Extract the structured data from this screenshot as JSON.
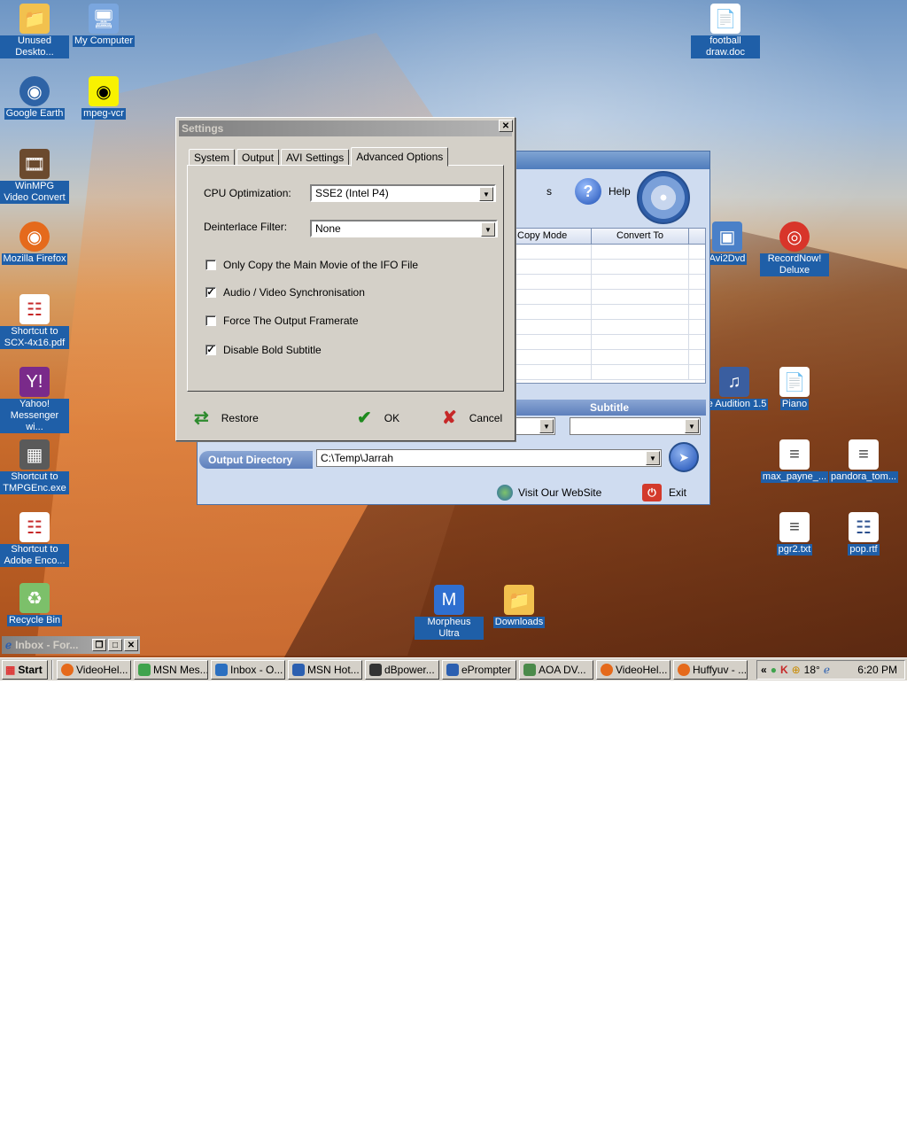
{
  "desktop_icons": [
    {
      "label": "Unused Deskto...",
      "icon": "folder-icon",
      "color": "#f2c14e"
    },
    {
      "label": "My Computer",
      "icon": "computer-icon",
      "color": "#7aa6de"
    },
    {
      "label": "football draw.doc",
      "icon": "document-icon",
      "color": "#ffffff"
    },
    {
      "label": "Google Earth",
      "icon": "globe-icon",
      "color": "#2e63a6"
    },
    {
      "label": "mpeg-vcr",
      "icon": "mpeg-vcr-icon",
      "color": "#f8f200"
    },
    {
      "label": "WinMPG Video Convert",
      "icon": "film-icon",
      "color": "#6b4a2e"
    },
    {
      "label": "Mozilla Firefox",
      "icon": "firefox-icon",
      "color": "#e56a1c"
    },
    {
      "label": "Shortcut to SCX-4x16.pdf",
      "icon": "pdf-icon",
      "color": "#ffffff"
    },
    {
      "label": "Avi2Dvd",
      "icon": "cube-icon",
      "color": "#4a80c8"
    },
    {
      "label": "RecordNow! Deluxe",
      "icon": "cd-icon",
      "color": "#d8352a"
    },
    {
      "label": "Yahoo! Messenger wi...",
      "icon": "yahoo-icon",
      "color": "#7a2a8a"
    },
    {
      "label": "be Audition 1.5",
      "icon": "audition-icon",
      "color": "#3a5ea0"
    },
    {
      "label": "Piano",
      "icon": "document-icon",
      "color": "#ffffff"
    },
    {
      "label": "Shortcut to TMPGEnc.exe",
      "icon": "tmpgenc-icon",
      "color": "#5a5a5a"
    },
    {
      "label": "max_payne_...",
      "icon": "textfile-icon",
      "color": "#ffffff"
    },
    {
      "label": "pandora_tom...",
      "icon": "textfile-icon",
      "color": "#ffffff"
    },
    {
      "label": "Shortcut to Adobe Enco...",
      "icon": "pdf-icon",
      "color": "#ffffff"
    },
    {
      "label": "pgr2.txt",
      "icon": "textfile-icon",
      "color": "#ffffff"
    },
    {
      "label": "pop.rtf",
      "icon": "rtf-icon",
      "color": "#ffffff"
    },
    {
      "label": "Recycle Bin",
      "icon": "recycle-bin-icon",
      "color": "#7cc06a"
    },
    {
      "label": "Morpheus Ultra",
      "icon": "morpheus-icon",
      "color": "#2f6fd0"
    },
    {
      "label": "Downloads",
      "icon": "folder-icon",
      "color": "#f2c14e"
    }
  ],
  "minimized_window": {
    "title": "Inbox - For..."
  },
  "app": {
    "help_label": "Help",
    "partial_toolbar_text": "s",
    "columns": [
      "Copy Mode",
      "Convert To"
    ],
    "subtitle_label": "Subtitle",
    "output_dir_label": "Output Directory",
    "output_dir_value": "C:\\Temp\\Jarrah",
    "visit_label": "Visit Our WebSite",
    "exit_label": "Exit"
  },
  "dialog": {
    "title": "Settings",
    "tabs": [
      "System",
      "Output",
      "AVI Settings",
      "Advanced Options"
    ],
    "active_tab": "Advanced Options",
    "cpu_label": "CPU  Optimization:",
    "cpu_value": "SSE2 (Intel P4)",
    "deinterlace_label": "Deinterlace Filter:",
    "deinterlace_value": "None",
    "checkboxes": [
      {
        "label": "Only Copy the Main Movie of the IFO File",
        "checked": false
      },
      {
        "label": "Audio / Video Synchronisation",
        "checked": true
      },
      {
        "label": "Force The Output Framerate",
        "checked": false
      },
      {
        "label": "Disable Bold Subtitle",
        "checked": true
      }
    ],
    "restore_label": "Restore",
    "ok_label": "OK",
    "cancel_label": "Cancel"
  },
  "taskbar": {
    "start_label": "Start",
    "buttons": [
      {
        "label": "VideoHel...",
        "icon": "firefox-icon"
      },
      {
        "label": "MSN Mes...",
        "icon": "msn-icon"
      },
      {
        "label": "Inbox - O...",
        "icon": "outlook-icon"
      },
      {
        "label": "MSN Hot...",
        "icon": "ie-icon"
      },
      {
        "label": "dBpower...",
        "icon": "dbpower-icon"
      },
      {
        "label": "ePrompter",
        "icon": "eprompter-icon"
      },
      {
        "label": "AOA DV...",
        "icon": "aoa-icon"
      },
      {
        "label": "VideoHel...",
        "icon": "firefox-icon"
      },
      {
        "label": "Huffyuv - ...",
        "icon": "firefox-icon"
      }
    ],
    "tray_chevron": "«",
    "temperature": "18°",
    "clock": "6:20 PM"
  }
}
